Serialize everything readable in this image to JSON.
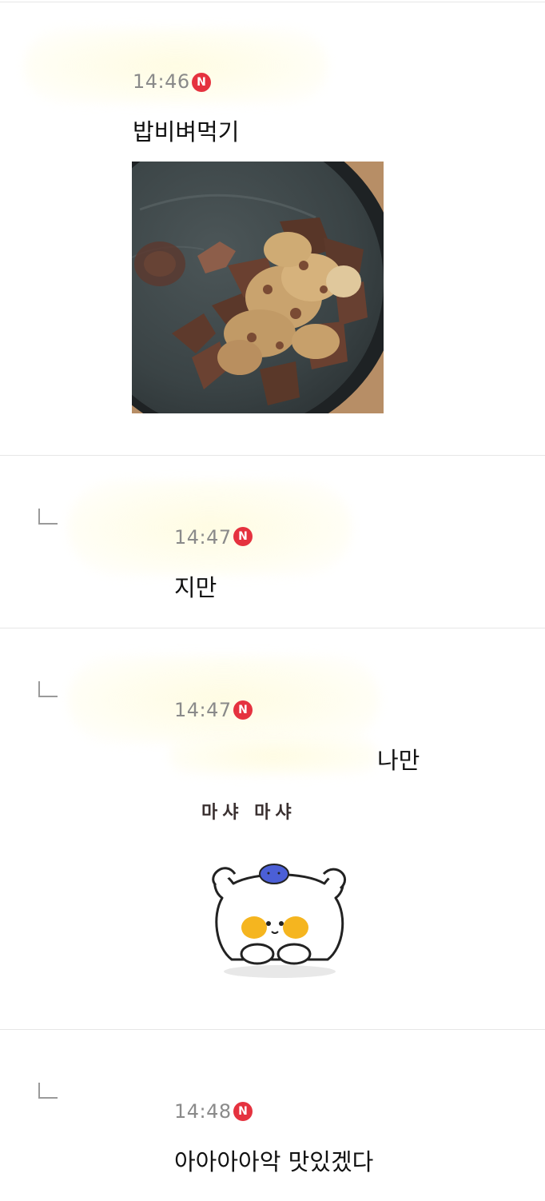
{
  "comments": [
    {
      "time": "14:46",
      "badge": "N",
      "text": "밥비벼먹기",
      "has_photo": true
    },
    {
      "time": "14:47",
      "badge": "N",
      "text": "지만"
    },
    {
      "time": "14:47",
      "badge": "N",
      "text": "나만",
      "sticker_text": "마샤 마샤"
    },
    {
      "time": "14:48",
      "badge": "N",
      "text": "아아아아악 맛있겠다"
    }
  ],
  "colors": {
    "badge": "#e5323f",
    "time": "#8a8a8a",
    "divider": "#e6e6e6"
  },
  "icons": {
    "reply": "reply-corner-icon",
    "new": "new-badge-icon"
  }
}
